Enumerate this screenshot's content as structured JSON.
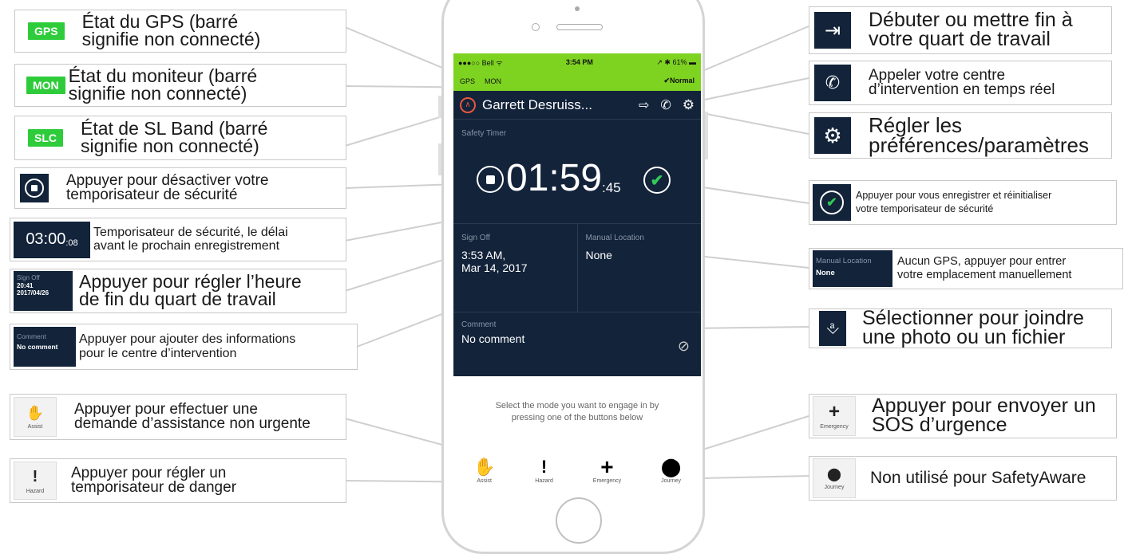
{
  "phone": {
    "status_bar": {
      "carrier": "●●●○○ Bell ᯤ",
      "time": "3:54 PM",
      "battery": "↗ ✱ 61% ▬"
    },
    "indicators": {
      "gps": "GPS",
      "mon": "MON",
      "status": "✔Normal"
    },
    "header": {
      "name": "Garrett Desruiss..."
    },
    "timer": {
      "label": "Safety Timer",
      "value": "01:59",
      "seconds": ":45"
    },
    "sign_off": {
      "label": "Sign Off",
      "value_line1": "3:53 AM,",
      "value_line2": "Mar 14, 2017"
    },
    "manual_location": {
      "label": "Manual Location",
      "value": "None"
    },
    "comment": {
      "label": "Comment",
      "value": "No comment"
    },
    "hint": {
      "line1": "Select the mode you want to engage in by",
      "line2": "pressing one of the buttons below"
    },
    "modes": [
      {
        "label": "Assist",
        "icon": "hand-icon"
      },
      {
        "label": "Hazard",
        "icon": "exclamation-icon"
      },
      {
        "label": "Emergency",
        "icon": "plus-icon"
      },
      {
        "label": "Journey",
        "icon": "location-pin-icon"
      }
    ]
  },
  "left": {
    "gps": {
      "badge": "GPS",
      "line1": "État du GPS (barré",
      "line2": "signifie non connecté)"
    },
    "mon": {
      "badge": "MON",
      "line1": "État du moniteur (barré",
      "line2": "signifie non connecté)"
    },
    "slc": {
      "badge": "SLC",
      "line1": "État de SL Band (barré",
      "line2": "signifie non connecté)"
    },
    "stop": {
      "line1": "Appuyer pour désactiver votre",
      "line2": "temporisateur de sécurité"
    },
    "timer": {
      "icon_text": "03:00",
      "icon_sec": ":08",
      "line1": "Temporisateur de sécurité, le délai",
      "line2": "avant le prochain enregistrement"
    },
    "signoff": {
      "icon_label": "Sign Off",
      "icon_time": "20:41",
      "icon_date": "2017/04/26",
      "line1": "Appuyer pour régler l’heure",
      "line2": "de fin du quart de travail"
    },
    "comment": {
      "icon_label": "Comment",
      "icon_value": "No comment",
      "line1": "Appuyer pour ajouter des informations",
      "line2": "pour le centre d’intervention"
    },
    "assist": {
      "icon_label": "Assist",
      "line1": "Appuyer pour effectuer une",
      "line2": "demande d’assistance non urgente"
    },
    "hazard": {
      "icon_label": "Hazard",
      "line1": "Appuyer pour régler un",
      "line2": "temporisateur de danger"
    }
  },
  "right": {
    "shift": {
      "line1": "Débuter ou mettre fin à",
      "line2": "votre quart de travail"
    },
    "call": {
      "line1": "Appeler votre centre",
      "line2": "d’intervention en temps réel"
    },
    "settings": {
      "line1": "Régler les",
      "line2": "préférences/paramètres"
    },
    "checkin": {
      "line1": "Appuyer pour vous enregistrer et réinitialiser",
      "line2": "votre temporisateur de sécurité"
    },
    "location": {
      "icon_label": "Manual Location",
      "icon_value": "None",
      "line1": "Aucun GPS, appuyer pour entrer",
      "line2": "votre emplacement manuellement"
    },
    "attach": {
      "line1": "Sélectionner pour joindre",
      "line2": "une photo ou un fichier"
    },
    "emergency": {
      "icon_label": "Emergency",
      "line1": "Appuyer pour envoyer un",
      "line2": "SOS d’urgence"
    },
    "journey": {
      "icon_label": "Journey",
      "line1": "Non utilisé pour SafetyAware"
    }
  },
  "colors": {
    "green": "#7ed321",
    "badge_green": "#2ecc3b",
    "navy": "#12233a",
    "check_green": "#34c759",
    "stop_red": "#e8573f"
  }
}
